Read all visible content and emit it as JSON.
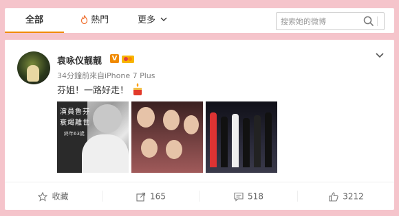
{
  "tabs": {
    "all": "全部",
    "hot": "熱門",
    "more": "更多"
  },
  "search": {
    "placeholder": "搜索她的微博"
  },
  "post": {
    "username": "袁咏仪靓靓",
    "verified_badge": "V",
    "meta": "34分鐘前來自iPhone 7 Plus",
    "text": "芬姐！一路好走！",
    "photo1_caption_line1": "演員鲁芬",
    "photo1_caption_line2": "衰竭離世",
    "photo1_caption_line3": "終年63歲"
  },
  "actions": {
    "favorite": "收藏",
    "repost": "165",
    "comment": "518",
    "like": "3212"
  },
  "colors": {
    "accent": "#f08a00",
    "background": "#f5c4cb",
    "hot_icon": "#f07030"
  }
}
